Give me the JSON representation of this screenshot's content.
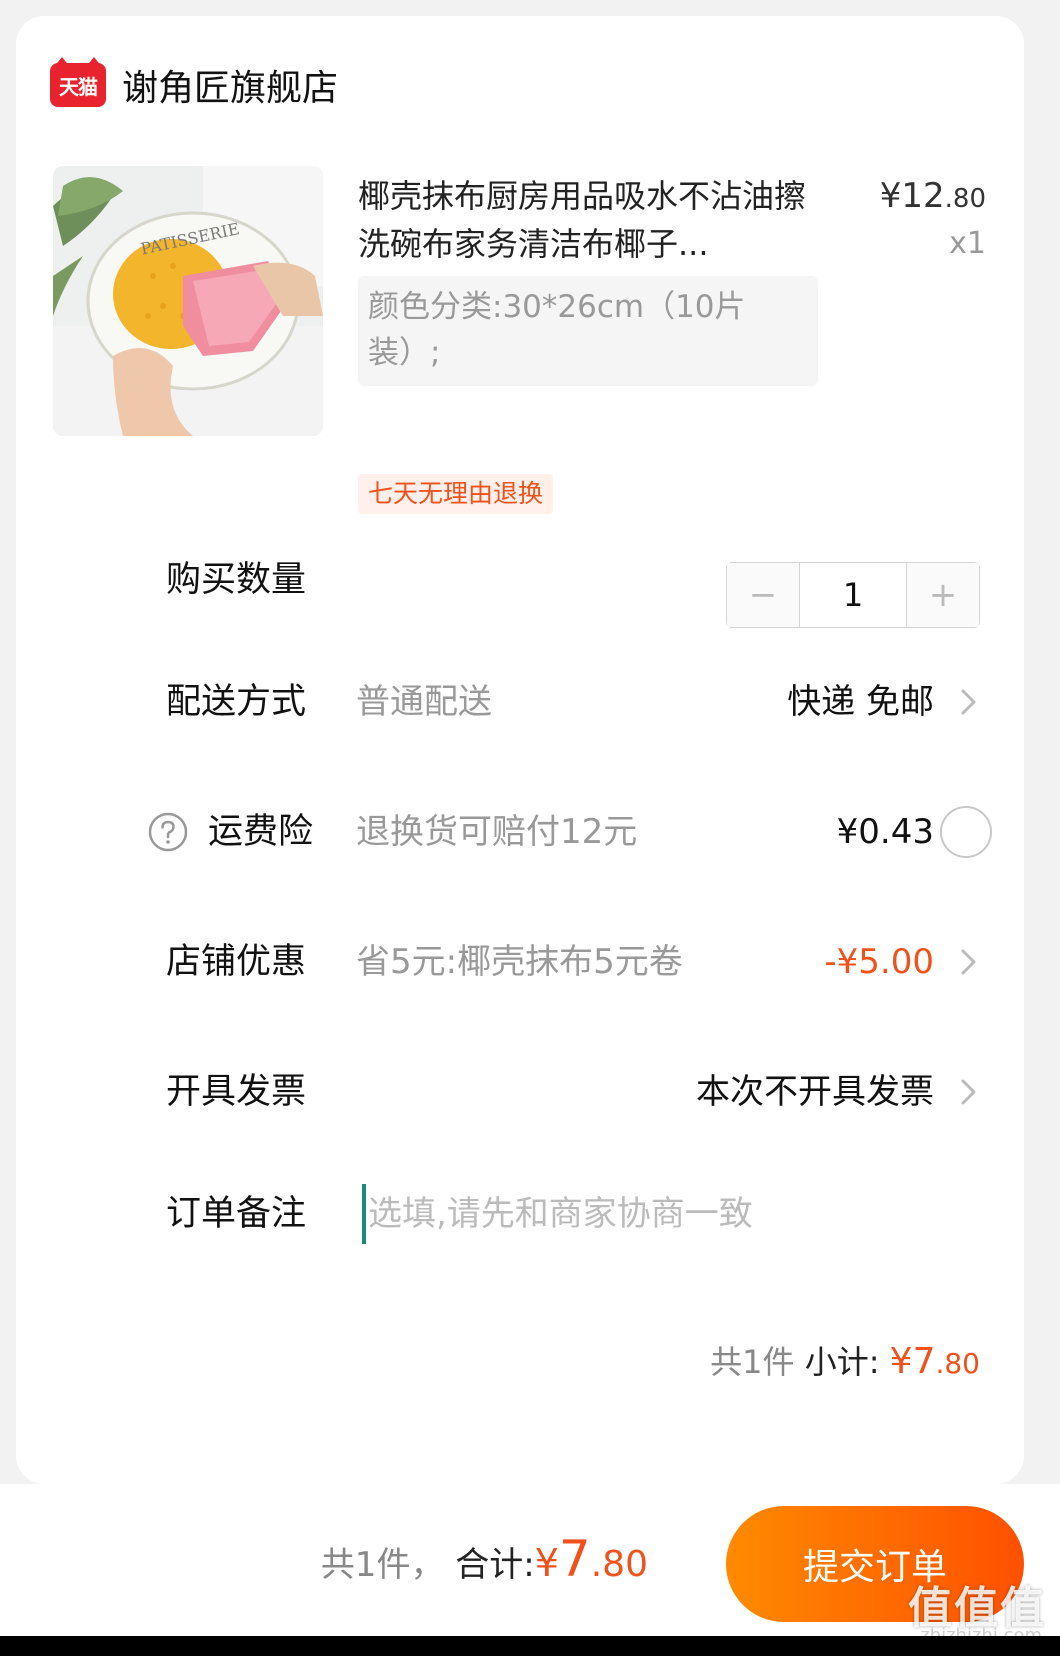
{
  "shop": {
    "badge": "天猫",
    "name": "谢角匠旗舰店"
  },
  "product": {
    "image_text": "PATISSERIE",
    "title": "椰壳抹布厨房用品吸水不沾油擦洗碗布家务清洁布椰子...",
    "price_symbol": "¥",
    "price_int": "12",
    "price_dec": ".80",
    "quantity_label": "x1",
    "sku": "颜色分类:30*26cm（10片装）;",
    "tag": "七天无理由退换"
  },
  "quantity": {
    "label": "购买数量",
    "value": "1",
    "minus": "−",
    "plus": "+"
  },
  "delivery": {
    "label": "配送方式",
    "method": "普通配送",
    "value": "快递 免邮"
  },
  "insurance": {
    "label": "运费险",
    "desc": "退换货可赔付12元",
    "price": "¥0.43"
  },
  "coupon": {
    "label": "店铺优惠",
    "desc": "省5元:椰壳抹布5元卷",
    "value": "-¥5.00"
  },
  "invoice": {
    "label": "开具发票",
    "value": "本次不开具发票"
  },
  "note": {
    "label": "订单备注",
    "placeholder": "选填,请先和商家协商一致"
  },
  "subtotal": {
    "count": "共1件",
    "label": "小计:",
    "symbol": "¥",
    "int": "7",
    "dec": ".80"
  },
  "footer": {
    "count": "共1件，",
    "label": "合计:",
    "symbol": "¥",
    "int": "7",
    "dec": ".80",
    "submit": "提交订单"
  },
  "watermark": {
    "main": "值值值",
    "sub": "zhizhizhi.com"
  },
  "colors": {
    "accent": "#f0521c",
    "brand": "#e8232e",
    "button_start": "#ff8a00",
    "button_end": "#ff5000"
  }
}
